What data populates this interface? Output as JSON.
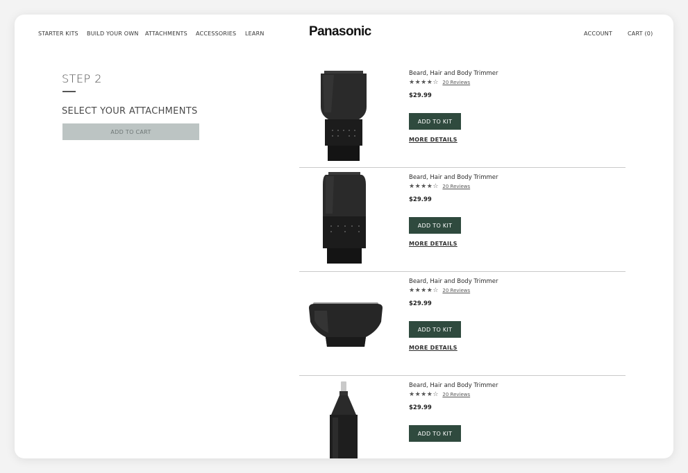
{
  "header": {
    "nav": [
      "STARTER KITS",
      "BUILD YOUR OWN",
      "ATTACHMENTS",
      "ACCESSORIES",
      "LEARN"
    ],
    "logo": "Panasonic",
    "account": "ACCOUNT",
    "cart": "CART (0)"
  },
  "builder": {
    "step": "STEP 2",
    "title": "SELECT YOUR ATTACHMENTS",
    "add_to_cart": "ADD TO CART"
  },
  "products": [
    {
      "name": "Beard, Hair and Body Trimmer",
      "rating": 4.5,
      "reviews": "20 Reviews",
      "price": "$29.99",
      "add_label": "ADD TO KIT",
      "details_label": "MORE DETAILS",
      "image": "beard-trimmer-attachment"
    },
    {
      "name": "Beard, Hair and Body Trimmer",
      "rating": 4.5,
      "reviews": "20 Reviews",
      "price": "$29.99",
      "add_label": "ADD TO KIT",
      "details_label": "MORE DETAILS",
      "image": "hair-trimmer-attachment"
    },
    {
      "name": "Beard, Hair and Body Trimmer",
      "rating": 4.5,
      "reviews": "20 Reviews",
      "price": "$29.99",
      "add_label": "ADD TO KIT",
      "details_label": "MORE DETAILS",
      "image": "foil-shaver-attachment"
    },
    {
      "name": "Beard, Hair and Body Trimmer",
      "rating": 4.5,
      "reviews": "20 Reviews",
      "price": "$29.99",
      "add_label": "ADD TO KIT",
      "image": "nose-trimmer-attachment"
    }
  ],
  "colors": {
    "accent": "#2f4a3e",
    "disabled_button": "#bcc4c3",
    "background": "#f3f3f3"
  }
}
